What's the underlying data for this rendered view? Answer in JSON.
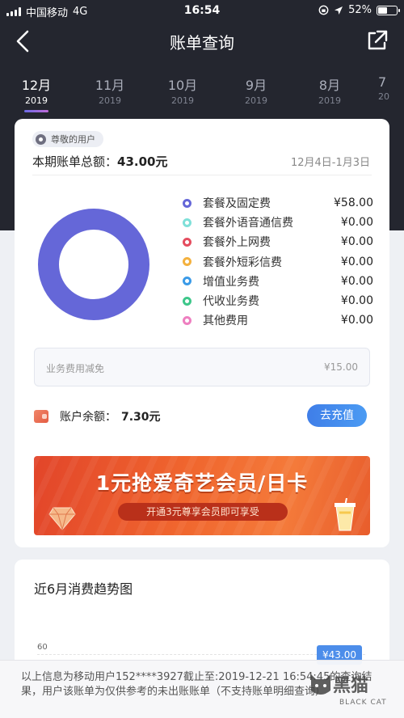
{
  "status_bar": {
    "carrier": "中国移动",
    "network": "4G",
    "time": "16:54",
    "battery": "52%",
    "battery_level": 0.52
  },
  "nav": {
    "title": "账单查询",
    "back_icon": "chevron-left-icon",
    "share_icon": "share-icon"
  },
  "tabs": [
    {
      "month": "12月",
      "year": "2019",
      "active": true
    },
    {
      "month": "11月",
      "year": "2019",
      "active": false
    },
    {
      "month": "10月",
      "year": "2019",
      "active": false
    },
    {
      "month": "9月",
      "year": "2019",
      "active": false
    },
    {
      "month": "8月",
      "year": "2019",
      "active": false
    },
    {
      "month": "7",
      "year": "20",
      "active": false
    }
  ],
  "bill": {
    "user_badge": "尊敬的用户",
    "total_label": "本期账单总额：",
    "total_value": "43.00元",
    "period": "12月4日-1月3日",
    "items": [
      {
        "label": "套餐及固定费",
        "amount": "¥58.00",
        "color": "#6567d8"
      },
      {
        "label": "套餐外语音通信费",
        "amount": "¥0.00",
        "color": "#7fe0d9"
      },
      {
        "label": "套餐外上网费",
        "amount": "¥0.00",
        "color": "#e54d5f"
      },
      {
        "label": "套餐外短彩信费",
        "amount": "¥0.00",
        "color": "#f4b13e"
      },
      {
        "label": "增值业务费",
        "amount": "¥0.00",
        "color": "#3b9be8"
      },
      {
        "label": "代收业务费",
        "amount": "¥0.00",
        "color": "#3ec78a"
      },
      {
        "label": "其他费用",
        "amount": "¥0.00",
        "color": "#ee7fc0"
      }
    ],
    "discount_label": "业务费用减免",
    "discount_value": "¥15.00",
    "balance_label": "账户余额：",
    "balance_value": "7.30元",
    "recharge_button": "去充值"
  },
  "banner": {
    "headline": "1元抢爱奇艺会员/日卡",
    "subtext": "开通3元尊享会员即可享受"
  },
  "trend": {
    "title": "近6月消费趋势图",
    "y_tick": "60",
    "value_label": "¥43.00"
  },
  "footer": {
    "disclaimer": "以上信息为移动用户152****3927截止至:2019-12-21 16:54:45的查询结果，用户该账单为仅供参考的未出账账单（不支持账单明细查询）"
  },
  "watermark": {
    "text": "黑猫",
    "sub": "BLACK CAT"
  },
  "colors": {
    "header_bg": "#24262f",
    "accent": "#4b8cee",
    "donut": "#6567d8"
  }
}
